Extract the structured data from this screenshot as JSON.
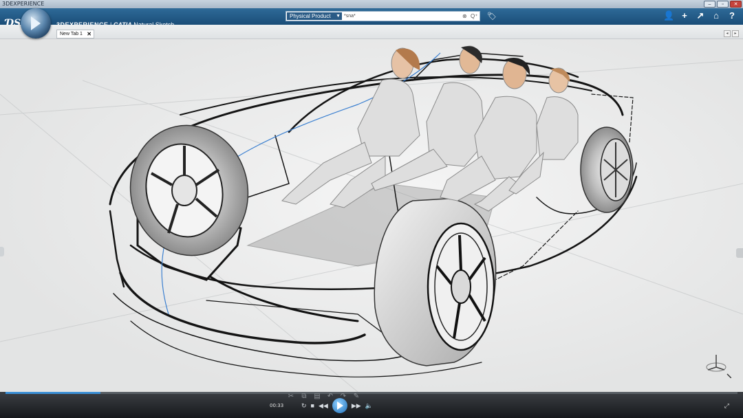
{
  "window": {
    "title": "3DEXPERIENCE",
    "controls": [
      "–",
      "▫",
      "✕"
    ]
  },
  "header": {
    "brand": "3DEXPERIENCE",
    "separator": " | ",
    "app_brand": "CATIA",
    "app_name": "Natural Sketch",
    "search": {
      "scope": "Physical Product",
      "value": "*sna*",
      "clear_icon": "⊗",
      "search_icon": "Q⁺"
    },
    "icons": [
      "user-icon",
      "add-icon",
      "share-icon",
      "home-icon",
      "help-icon"
    ],
    "icon_glyphs": [
      "👤",
      "+",
      "↗",
      "⌂",
      "?"
    ],
    "brand_color": "#1f5788"
  },
  "tabs": [
    {
      "label": "New Tab 1",
      "close": "✕"
    }
  ],
  "player": {
    "time": "00:33",
    "progress": 0.13
  },
  "colors": {
    "accent": "#3a8fd6",
    "curve_blue": "#3a7fd0"
  }
}
